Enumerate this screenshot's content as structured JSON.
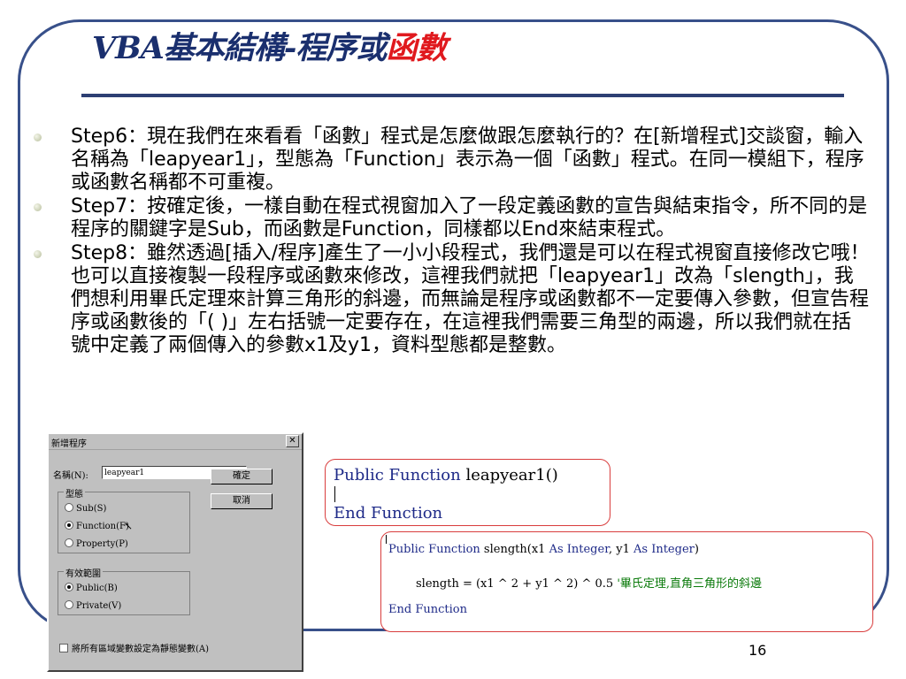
{
  "title": {
    "main": "VBA基本結構-程序或",
    "accent": "函數"
  },
  "bullets": [
    "Step6：現在我們在來看看「函數」程式是怎麼做跟怎麼執行的？在[新增程式]交談窗，輸入名稱為「leapyear1」，型態為「Function」表示為一個「函數」程式。在同一模組下，程序或函數名稱都不可重複。",
    "Step7：按確定後，一樣自動在程式視窗加入了一段定義函數的宣告與結束指令，所不同的是程序的關鍵字是Sub，而函數是Function，同樣都以End來結束程式。",
    "Step8：雖然透過[插入/程序]產生了一小小段程式，我們還是可以在程式視窗直接修改它哦！也可以直接複製一段程序或函數來修改，這裡我們就把「leapyear1」改為「slength」，我們想利用畢氏定理來計算三角形的斜邊，而無論是程序或函數都不一定要傳入參數，但宣告程序或函數後的「( )」左右括號一定要存在，在這裡我們需要三角型的兩邊，所以我們就在括號中定義了兩個傳入的參數x1及y1，資料型態都是整數。"
  ],
  "dialog": {
    "title": "新增程序",
    "close": "✕",
    "name_label": "名稱(N):",
    "name_value": "leapyear1",
    "ok_label": "確定",
    "cancel_label": "取消",
    "type_group": "型態",
    "type_options": [
      "Sub(S)",
      "Function(F)",
      "Property(P)"
    ],
    "type_selected": 1,
    "scope_group": "有效範圍",
    "scope_options": [
      "Public(B)",
      "Private(V)"
    ],
    "scope_selected": 0,
    "static_checkbox": "將所有區域變數設定為靜態變數(A)"
  },
  "code1": {
    "line1_kw": "Public Function",
    "line1_rest": " leapyear1()",
    "line2": "End Function"
  },
  "code2": {
    "line1": [
      {
        "t": "Public Function",
        "kw": true
      },
      {
        "t": " slength(x1 ",
        "kw": false
      },
      {
        "t": "As Integer",
        "kw": true
      },
      {
        "t": ", y1 ",
        "kw": false
      },
      {
        "t": "As Integer",
        "kw": true
      },
      {
        "t": ")",
        "kw": false
      }
    ],
    "line2_code": "slength = (x1 ^ 2 + y1 ^ 2) ^ 0.5  ",
    "line2_comment": "'畢氏定理,直角三角形的斜邊",
    "line3": "End Function"
  },
  "page_number": "16",
  "colors": {
    "frame": "#38508a",
    "title": "#1a2f6e",
    "accent": "#e0191e",
    "code_keyword": "#1e2a88",
    "code_comment": "#0a7a0a"
  }
}
